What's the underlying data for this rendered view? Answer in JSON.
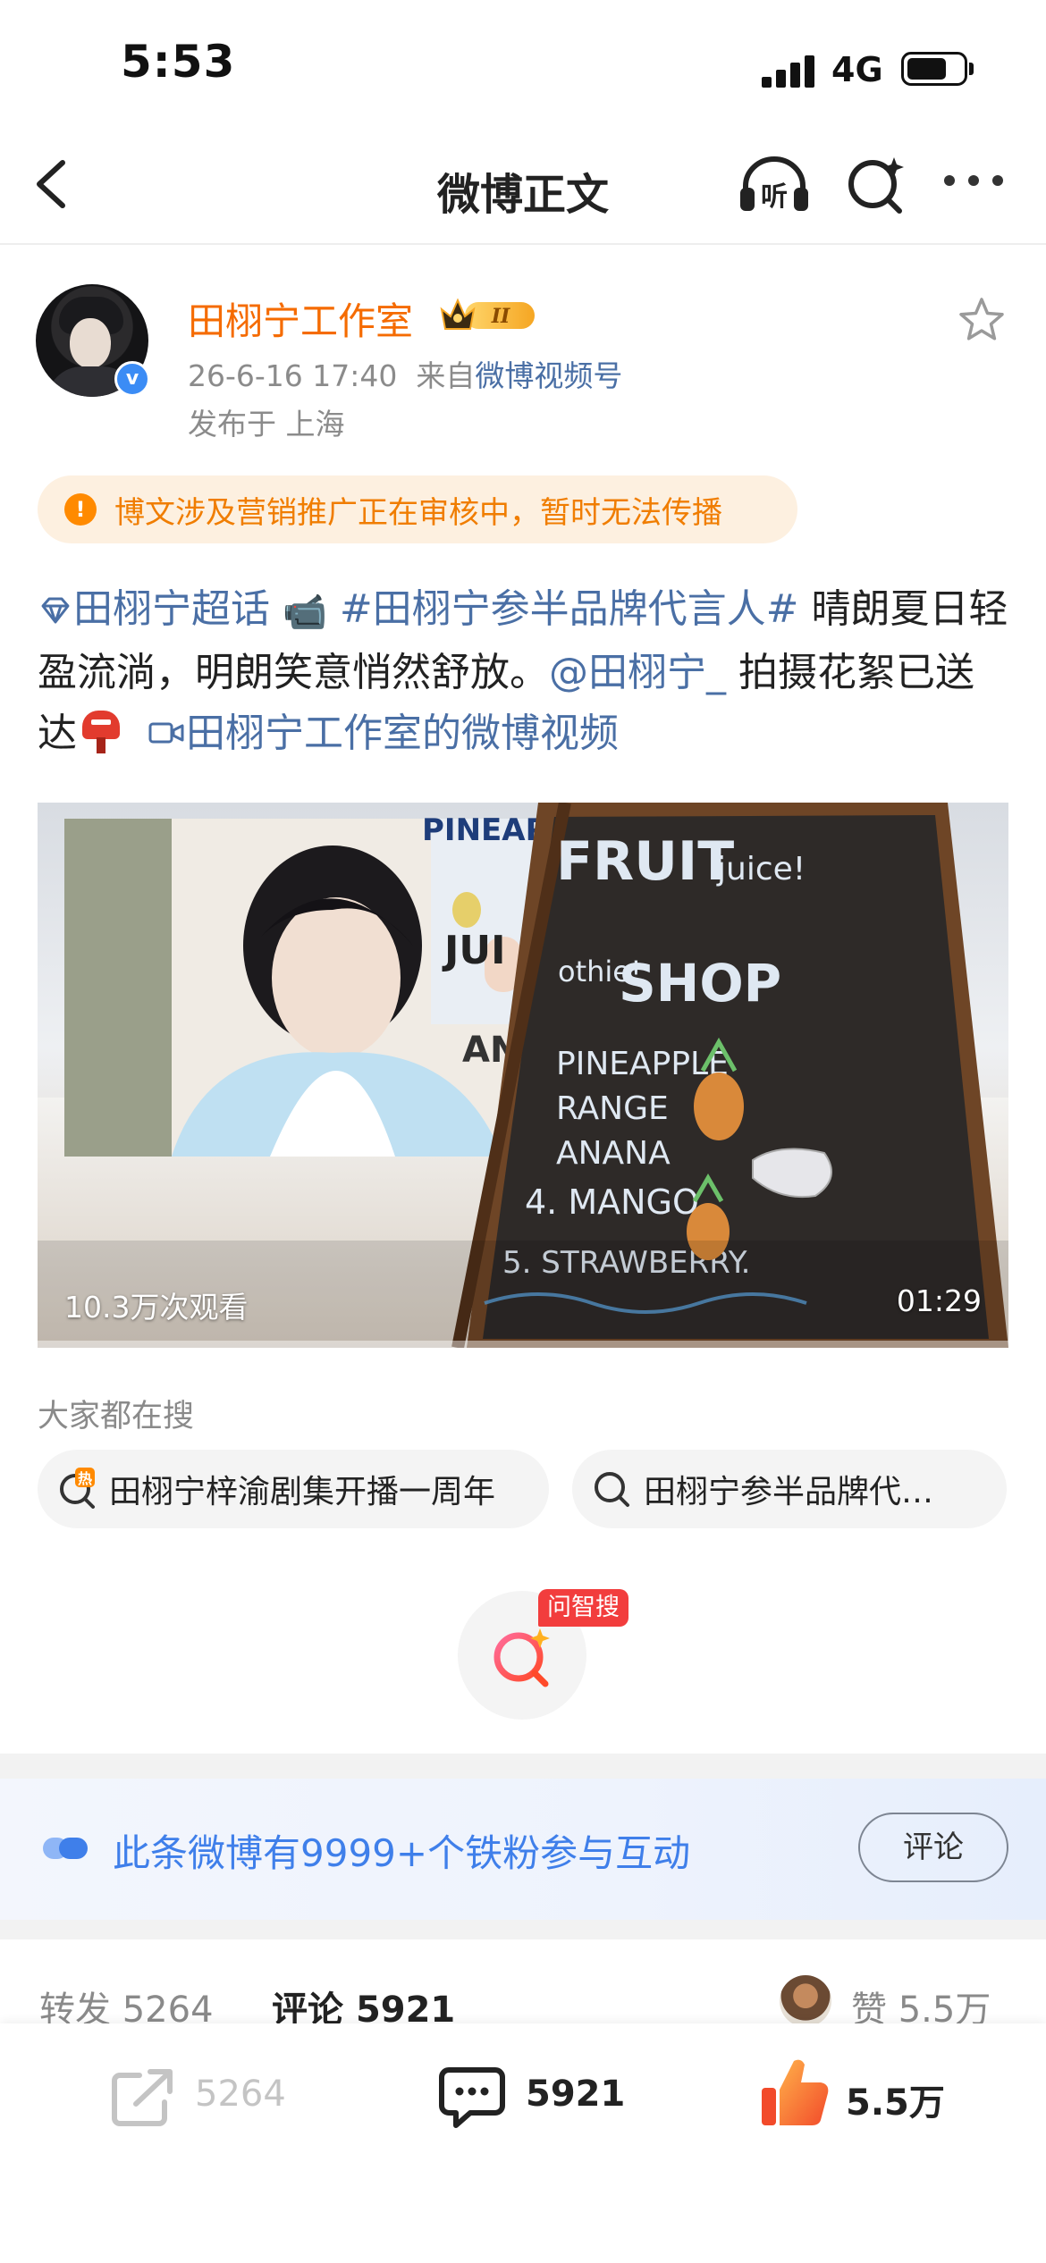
{
  "status_bar": {
    "time": "5:53",
    "network": "4G",
    "icons": [
      "signal-icon",
      "battery-icon"
    ]
  },
  "nav": {
    "title": "微博正文",
    "listen_label": "听",
    "icons": [
      "back-icon",
      "listen-headphone-icon",
      "ai-search-icon",
      "more-icon"
    ]
  },
  "author": {
    "name": "田栩宁工作室",
    "vip_level": "II",
    "date": "26-6-16 17:40",
    "source_prefix": "来自",
    "source": "微博视频号",
    "location": "发布于 上海",
    "verified_mark": "v"
  },
  "warning": {
    "icon": "!",
    "text": "博文涉及营销推广正在审核中，暂时无法传播"
  },
  "post": {
    "supertopic": "田栩宁超话",
    "camera_emoji": "📹",
    "hashtag": "#田栩宁参半品牌代言人#",
    "text1": " 晴朗夏日轻盈流淌，明朗笑意悄然舒放。",
    "mention": "@田栩宁_",
    "text2": " 拍摄花絮已送达",
    "video_link": "田栩宁工作室的微博视频"
  },
  "video": {
    "views": "10.3万次观看",
    "duration": "01:29",
    "board_words": [
      "FRUIT",
      "juice!",
      "othie!",
      "SHOP",
      "PINEAPPLE",
      "RANGE",
      "ANANA",
      "4. MANGO.",
      "5. STRAWBERRY."
    ],
    "sign_text": [
      "PINEAPP",
      "JUI",
      "AN"
    ]
  },
  "trending": {
    "title": "大家都在搜",
    "items": [
      {
        "text": "田栩宁梓渝剧集开播一周年",
        "badge": "热"
      },
      {
        "text": "田栩宁参半品牌代…"
      }
    ]
  },
  "ai_search": {
    "tag": "问智搜"
  },
  "fans": {
    "text": "此条微博有9999+个铁粉参与互动",
    "button": "评论"
  },
  "tabs": {
    "repost_label": "转发",
    "repost_count": "5264",
    "comment_label": "评论",
    "comment_count": "5921",
    "like_label": "赞",
    "like_count": "5.5万"
  },
  "bottom_bar": {
    "repost": "5264",
    "comment": "5921",
    "like": "5.5万"
  },
  "colors": {
    "brand_orange": "#f56b00",
    "link_blue": "#4a6fa5",
    "warning_bg": "#fdf0e0",
    "warning_text": "#f07d00",
    "fans_blue": "#3f7fea"
  }
}
